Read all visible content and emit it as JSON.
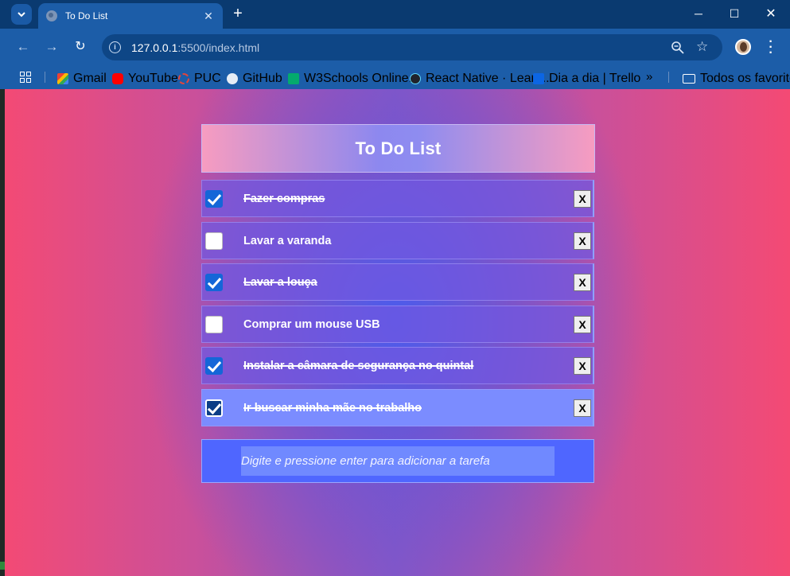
{
  "browser": {
    "tab_title": "To Do List",
    "url_host": "127.0.0.1",
    "url_rest": ":5500/index.html",
    "bookmarks": [
      {
        "label": "Gmail",
        "icon": "gmail-icon"
      },
      {
        "label": "YouTube",
        "icon": "youtube-icon"
      },
      {
        "label": "PUC",
        "icon": "puc-icon"
      },
      {
        "label": "GitHub",
        "icon": "github-icon"
      },
      {
        "label": "W3Schools Online...",
        "icon": "w3schools-icon"
      },
      {
        "label": "React Native · Learn...",
        "icon": "react-icon"
      },
      {
        "label": "Dia a dia | Trello",
        "icon": "trello-icon"
      }
    ],
    "more_bookmarks": "»",
    "all_bookmarks": "Todos os favoritos",
    "colors": {
      "frame": "#0a3a70",
      "toolbar": "#1c5da8"
    }
  },
  "app": {
    "title": "To Do List",
    "tasks": [
      {
        "text": "Fazer compras",
        "done": true
      },
      {
        "text": "Lavar a varanda",
        "done": false
      },
      {
        "text": "Lavar a louça",
        "done": true
      },
      {
        "text": "Comprar um mouse USB",
        "done": false
      },
      {
        "text": "Instalar a câmara de segurança no quintal",
        "done": true
      },
      {
        "text": "Ir buscar minha mãe no trabalho",
        "done": true
      }
    ],
    "delete_label": "X",
    "input_placeholder": "Digite e pressione enter para adicionar a tarefa",
    "colors": {
      "accent": "#4f66ff",
      "checkbox": "#1466d8"
    }
  }
}
